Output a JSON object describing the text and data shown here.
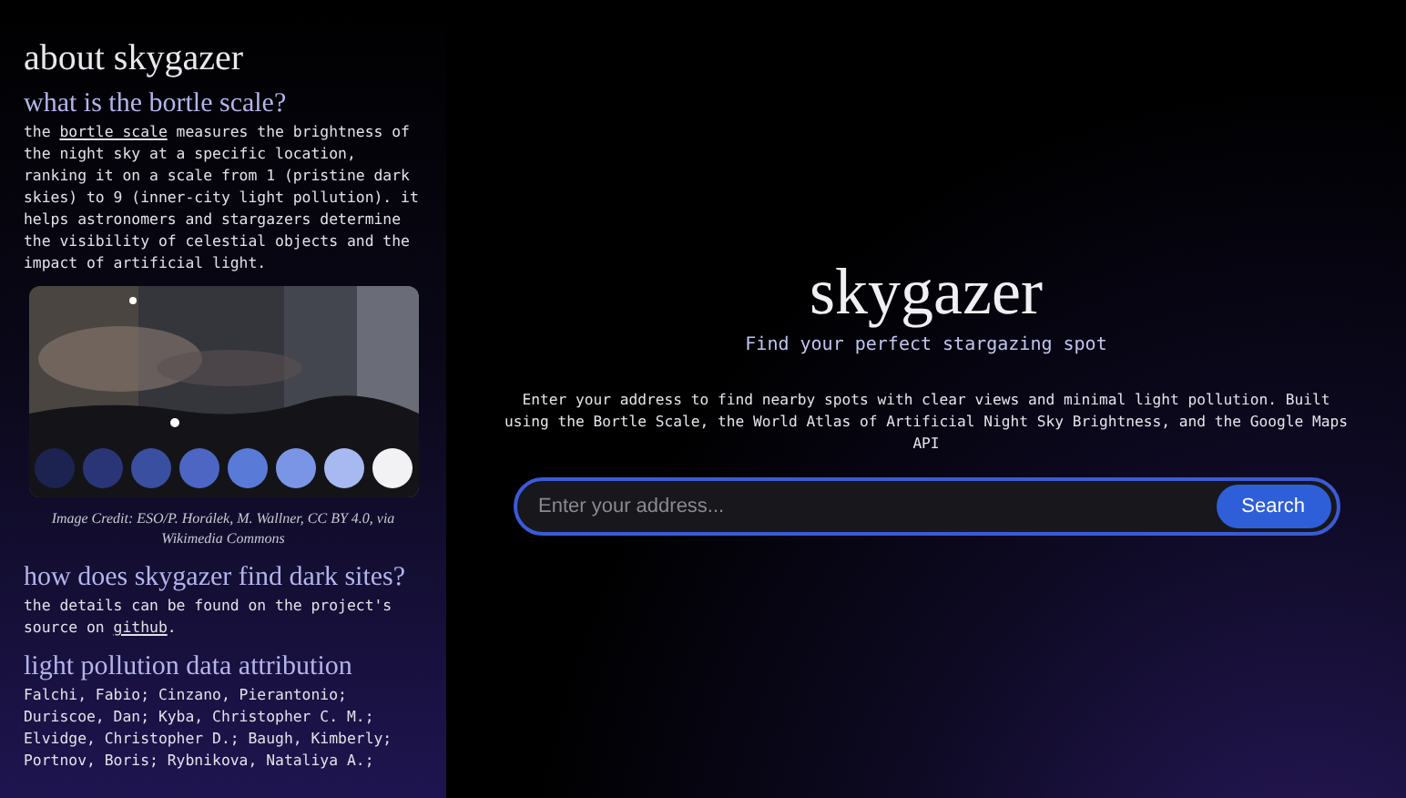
{
  "sidebar": {
    "title": "about skygazer",
    "sections": [
      {
        "kind": "text",
        "heading": "what is the bortle scale?",
        "before": "the ",
        "link": "bortle scale",
        "after": " measures the brightness of the night sky at a specific location, ranking it on a scale from 1 (pristine dark skies) to 9 (inner-city light pollution). it helps astronomers and stargazers determine the visibility of celestial objects and the impact of artificial light."
      },
      {
        "caption": "Image Credit: ESO/P. Horálek, M. Wallner, CC BY 4.0, via Wikimedia Commons"
      },
      {
        "kind": "text",
        "heading": "how does skygazer find dark sites?",
        "before": "the details can be found on the project's source on ",
        "link": "github",
        "after": "."
      },
      {
        "kind": "plain",
        "heading": "light pollution data attribution",
        "body": "Falchi, Fabio; Cinzano, Pierantonio; Duriscoe, Dan; Kyba, Christopher C. M.; Elvidge, Christopher D.; Baugh, Kimberly; Portnov, Boris; Rybnikova, Nataliya A.;"
      }
    ]
  },
  "main": {
    "title": "skygazer",
    "subtitle": "Find your perfect stargazing spot",
    "description": "Enter your address to find nearby spots with clear views and minimal light pollution. Built using the Bortle Scale, the World Atlas of Artificial Night Sky Brightness, and the Google Maps API",
    "search": {
      "placeholder": "Enter your address...",
      "button": "Search"
    }
  }
}
